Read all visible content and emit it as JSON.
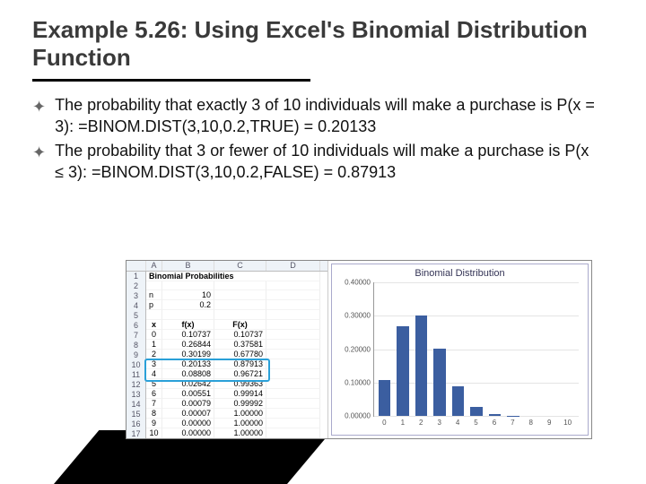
{
  "title": "Example 5.26: Using Excel's Binomial Distribution Function",
  "bullets": [
    "The probability that exactly 3 of 10 individuals will make a purchase is P(x = 3): =BINOM.DIST(3,10,0.2,TRUE) = 0.20133",
    "The probability that 3 or fewer of 10 individuals will make a purchase is P(x ≤ 3): =BINOM.DIST(3,10,0.2,FALSE) = 0.87913"
  ],
  "sheet": {
    "title_cell": "Binomial Probabilities",
    "cols": [
      "A",
      "B",
      "C",
      "D"
    ],
    "n_label": "n",
    "n_value": "10",
    "p_label": "p",
    "p_value": "0.2",
    "x_label": "x",
    "fx_label": "f(x)",
    "Fx_label": "F(x)",
    "rows": [
      {
        "x": "0",
        "fx": "0.10737",
        "Fx": "0.10737"
      },
      {
        "x": "1",
        "fx": "0.26844",
        "Fx": "0.37581"
      },
      {
        "x": "2",
        "fx": "0.30199",
        "Fx": "0.67780"
      },
      {
        "x": "3",
        "fx": "0.20133",
        "Fx": "0.87913"
      },
      {
        "x": "4",
        "fx": "0.08808",
        "Fx": "0.96721"
      },
      {
        "x": "5",
        "fx": "0.02642",
        "Fx": "0.99363"
      },
      {
        "x": "6",
        "fx": "0.00551",
        "Fx": "0.99914"
      },
      {
        "x": "7",
        "fx": "0.00079",
        "Fx": "0.99992"
      },
      {
        "x": "8",
        "fx": "0.00007",
        "Fx": "1.00000"
      },
      {
        "x": "9",
        "fx": "0.00000",
        "Fx": "1.00000"
      },
      {
        "x": "10",
        "fx": "0.00000",
        "Fx": "1.00000"
      }
    ]
  },
  "chart_data": {
    "type": "bar",
    "title": "Binomial Distribution",
    "categories": [
      "0",
      "1",
      "2",
      "3",
      "4",
      "5",
      "6",
      "7",
      "8",
      "9",
      "10"
    ],
    "values": [
      0.10737,
      0.26844,
      0.30199,
      0.20133,
      0.08808,
      0.02642,
      0.00551,
      0.00079,
      7e-05,
      0,
      0
    ],
    "ylim": [
      0,
      0.4
    ],
    "yticks": [
      "0.00000",
      "0.10000",
      "0.20000",
      "0.30000",
      "0.40000"
    ],
    "xlabel": "",
    "ylabel": ""
  }
}
